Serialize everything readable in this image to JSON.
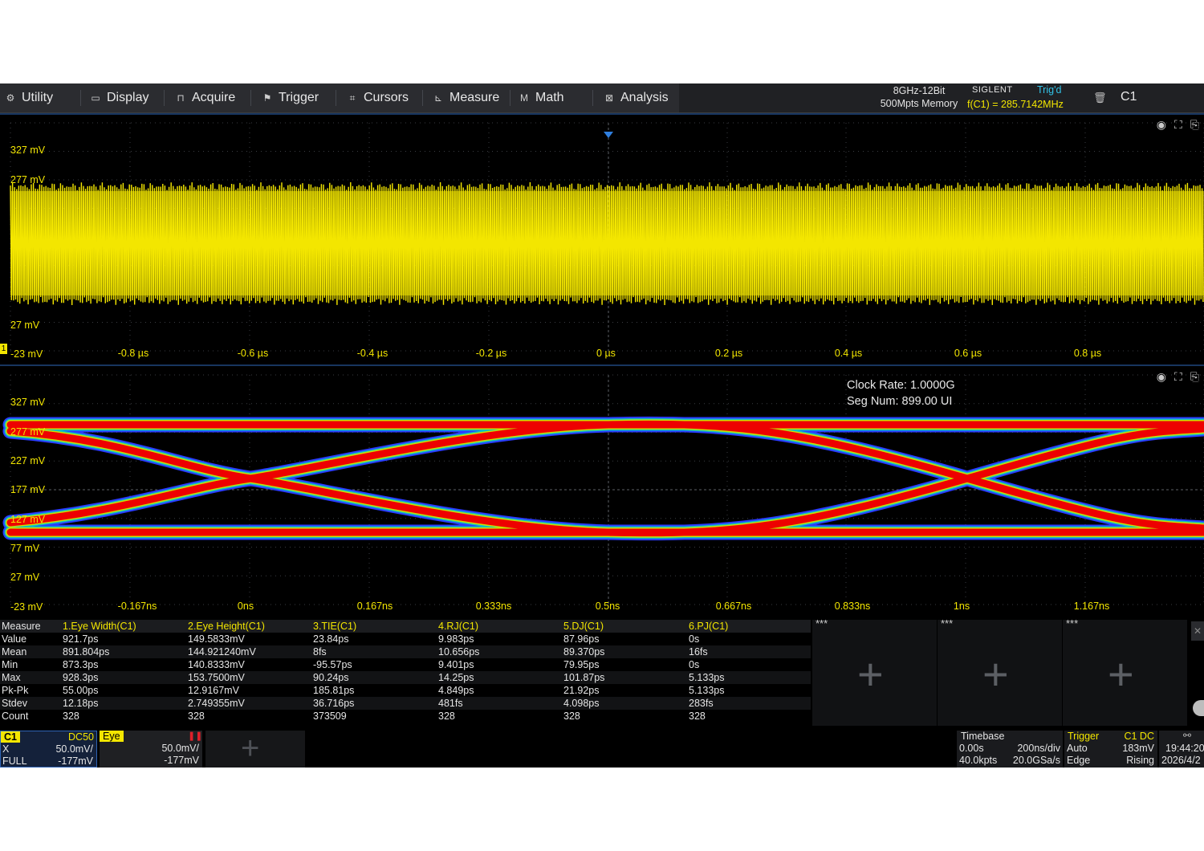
{
  "menu": [
    {
      "label": "Utility",
      "icon": "gear-icon",
      "glyph": "⚙"
    },
    {
      "label": "Display",
      "icon": "monitor-icon",
      "glyph": "▭"
    },
    {
      "label": "Acquire",
      "icon": "acquire-icon",
      "glyph": "⊓"
    },
    {
      "label": "Trigger",
      "icon": "flag-icon",
      "glyph": "⚑"
    },
    {
      "label": "Cursors",
      "icon": "crosshair-icon",
      "glyph": "⌗"
    },
    {
      "label": "Measure",
      "icon": "ruler-icon",
      "glyph": "⊾"
    },
    {
      "label": "Math",
      "icon": "math-icon",
      "glyph": "M"
    },
    {
      "label": "Analysis",
      "icon": "analysis-icon",
      "glyph": "⊠"
    }
  ],
  "status": {
    "bandwidth": "8GHz-12Bit",
    "memory": "500Mpts Memory",
    "brand": "SIGLENT",
    "trig_state": "Trig'd",
    "frequency": "f(C1) = 285.7142MHz",
    "channel": "C1"
  },
  "waveform": {
    "y_labels": [
      "327 mV",
      "277 mV",
      "27 mV",
      "-23 mV"
    ],
    "x_labels": [
      "-0.8 µs",
      "-0.6 µs",
      "-0.4 µs",
      "-0.2 µs",
      "0 µs",
      "0.2 µs",
      "0.4 µs",
      "0.6 µs",
      "0.8 µs"
    ],
    "marker": "1",
    "trace_color": "#f3e600"
  },
  "eye": {
    "clock_rate": "Clock Rate: 1.0000G",
    "seg_num": "Seg Num: 899.00 UI",
    "y_labels": [
      "327 mV",
      "277 mV",
      "227 mV",
      "177 mV",
      "127 mV",
      "77 mV",
      "27 mV",
      "-23 mV"
    ],
    "x_labels": [
      "-0.167ns",
      "0ns",
      "0.167ns",
      "0.333ns",
      "0.5ns",
      "0.667ns",
      "0.833ns",
      "1ns",
      "1.167ns"
    ],
    "trace_color": "#ee0000"
  },
  "measure": {
    "row_labels": [
      "Measure",
      "Value",
      "Mean",
      "Min",
      "Max",
      "Pk-Pk",
      "Stdev",
      "Count"
    ],
    "columns": [
      {
        "name": "1.Eye Width(C1)",
        "values": [
          "921.7ps",
          "891.804ps",
          "873.3ps",
          "928.3ps",
          "55.00ps",
          "12.18ps",
          "328"
        ]
      },
      {
        "name": "2.Eye Height(C1)",
        "values": [
          "149.5833mV",
          "144.921240mV",
          "140.8333mV",
          "153.7500mV",
          "12.9167mV",
          "2.749355mV",
          "328"
        ]
      },
      {
        "name": "3.TIE(C1)",
        "values": [
          "23.84ps",
          "8fs",
          "-95.57ps",
          "90.24ps",
          "185.81ps",
          "36.716ps",
          "373509"
        ]
      },
      {
        "name": "4.RJ(C1)",
        "values": [
          "9.983ps",
          "10.656ps",
          "9.401ps",
          "14.25ps",
          "4.849ps",
          "481fs",
          "328"
        ]
      },
      {
        "name": "5.DJ(C1)",
        "values": [
          "87.96ps",
          "89.370ps",
          "79.95ps",
          "101.87ps",
          "21.92ps",
          "4.098ps",
          "328"
        ]
      },
      {
        "name": "6.PJ(C1)",
        "values": [
          "0s",
          "16fs",
          "0s",
          "5.133ps",
          "5.133ps",
          "283fs",
          "328"
        ]
      }
    ],
    "empty_slots": [
      "***",
      "***",
      "***"
    ]
  },
  "channels": {
    "c1": {
      "tag": "C1",
      "coupling": "DC50",
      "scale_label": "X",
      "scale": "50.0mV/",
      "offset_label": "FULL",
      "offset": "-177mV"
    },
    "eye": {
      "tag": "Eye",
      "scale": "50.0mV/",
      "offset": "-177mV"
    }
  },
  "timebase": {
    "title": "Timebase",
    "delay": "0.00s",
    "scale": "200ns/div",
    "points": "40.0kpts",
    "rate": "20.0GSa/s"
  },
  "trigger": {
    "title": "Trigger",
    "source": "C1 DC",
    "mode": "Auto",
    "level": "183mV",
    "type": "Edge",
    "slope": "Rising"
  },
  "clock": {
    "time": "19:44:20",
    "date": "2026/4/2"
  }
}
